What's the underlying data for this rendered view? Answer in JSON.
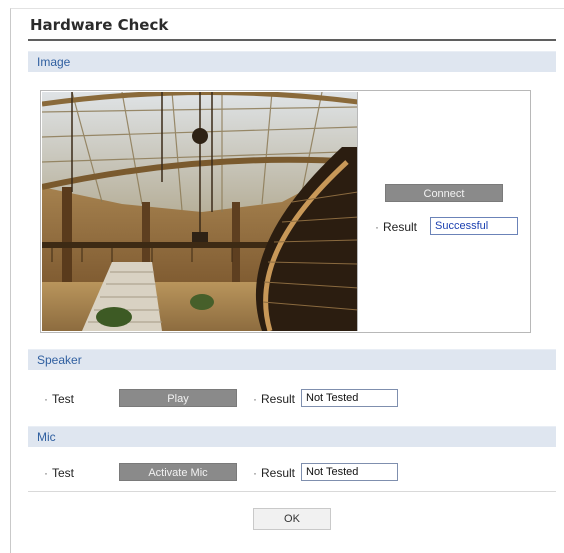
{
  "page": {
    "title": "Hardware Check"
  },
  "sections": {
    "image": {
      "label": "Image",
      "preview_alt": "Atrium with grand staircase and glass skylight",
      "connect_label": "Connect",
      "result_label": "Result",
      "result_value": "Successful"
    },
    "speaker": {
      "label": "Speaker",
      "test_label": "Test",
      "play_label": "Play",
      "result_label": "Result",
      "result_value": "Not Tested"
    },
    "mic": {
      "label": "Mic",
      "test_label": "Test",
      "activate_label": "Activate Mic",
      "result_label": "Result",
      "result_value": "Not Tested"
    }
  },
  "footer": {
    "ok_label": "OK"
  },
  "colors": {
    "section_bg": "#dfe6f0",
    "section_text": "#2f5fa0",
    "button_dark": "#8a8a8a",
    "success_text": "#1a3fb0"
  }
}
